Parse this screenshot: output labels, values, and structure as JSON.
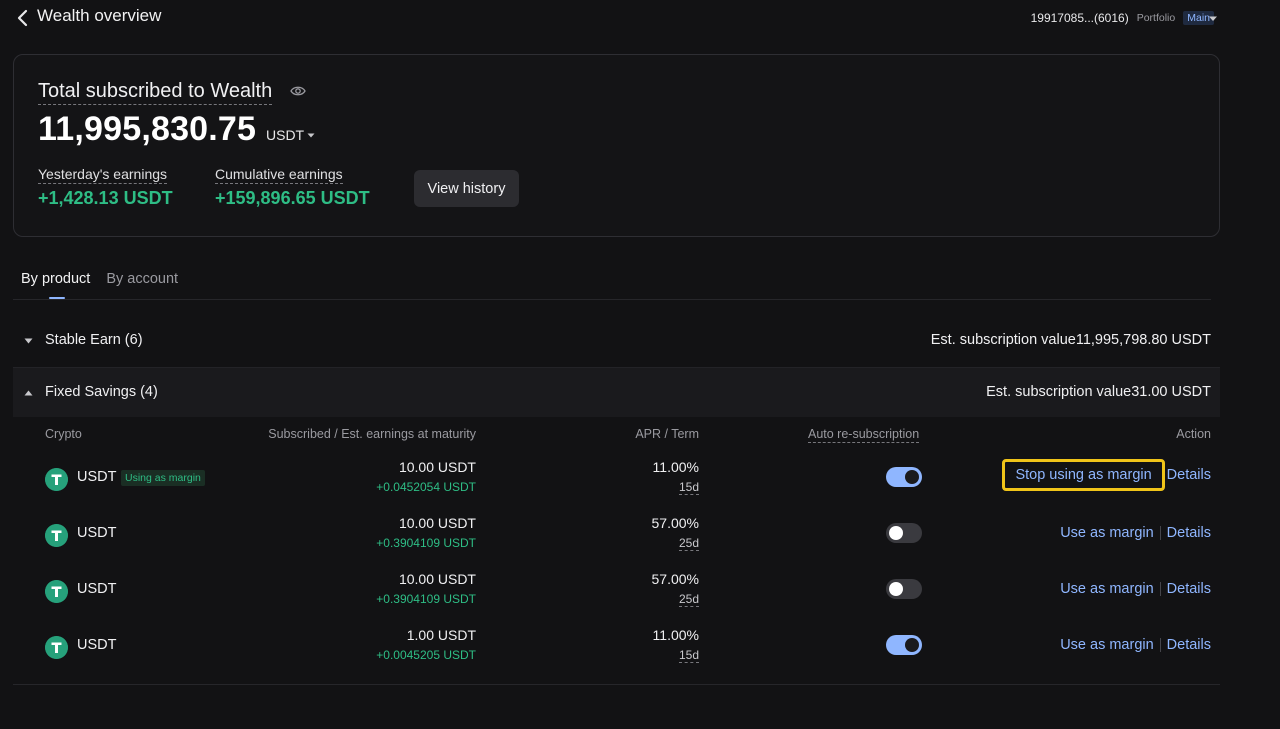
{
  "header": {
    "title": "Wealth overview",
    "account_id": "19917085...(6016)",
    "portfolio_label": "Portfolio",
    "account_tag": "Main"
  },
  "summary": {
    "total_label": "Total subscribed to Wealth",
    "total_value": "11,995,830.75",
    "total_unit": "USDT",
    "yesterday_label": "Yesterday's earnings",
    "yesterday_value": "+1,428.13 USDT",
    "cumulative_label": "Cumulative earnings",
    "cumulative_value": "+159,896.65 USDT",
    "history_button": "View history"
  },
  "tabs": [
    {
      "label": "By product",
      "active": true
    },
    {
      "label": "By account",
      "active": false
    }
  ],
  "groups": {
    "stable": {
      "name": "Stable Earn (6)",
      "est_label": "Est. subscription value",
      "est_value": "11,995,798.80 USDT"
    },
    "fixed": {
      "name": "Fixed Savings (4)",
      "est_label": "Est. subscription value",
      "est_value": "31.00 USDT"
    }
  },
  "table": {
    "headers": {
      "crypto": "Crypto",
      "subscribed": "Subscribed / Est. earnings at maturity",
      "apr": "APR / Term",
      "auto": "Auto re-subscription",
      "action": "Action"
    },
    "rows": [
      {
        "coin": "USDT",
        "badge": "Using as margin",
        "amount": "10.00 USDT",
        "earnings": "+0.0452054 USDT",
        "apr": "11.00%",
        "term": "15d",
        "auto": true,
        "margin_action": "Stop using as margin",
        "details": "Details"
      },
      {
        "coin": "USDT",
        "badge": "",
        "amount": "10.00 USDT",
        "earnings": "+0.3904109 USDT",
        "apr": "57.00%",
        "term": "25d",
        "auto": false,
        "margin_action": "Use as margin",
        "details": "Details"
      },
      {
        "coin": "USDT",
        "badge": "",
        "amount": "10.00 USDT",
        "earnings": "+0.3904109 USDT",
        "apr": "57.00%",
        "term": "25d",
        "auto": false,
        "margin_action": "Use as margin",
        "details": "Details"
      },
      {
        "coin": "USDT",
        "badge": "",
        "amount": "1.00 USDT",
        "earnings": "+0.0045205 USDT",
        "apr": "11.00%",
        "term": "15d",
        "auto": true,
        "margin_action": "Use as margin",
        "details": "Details"
      }
    ]
  },
  "colors": {
    "accent": "#8fb6ff",
    "positive": "#2ebd85",
    "highlight": "#f0c419",
    "tether": "#26a17b"
  }
}
